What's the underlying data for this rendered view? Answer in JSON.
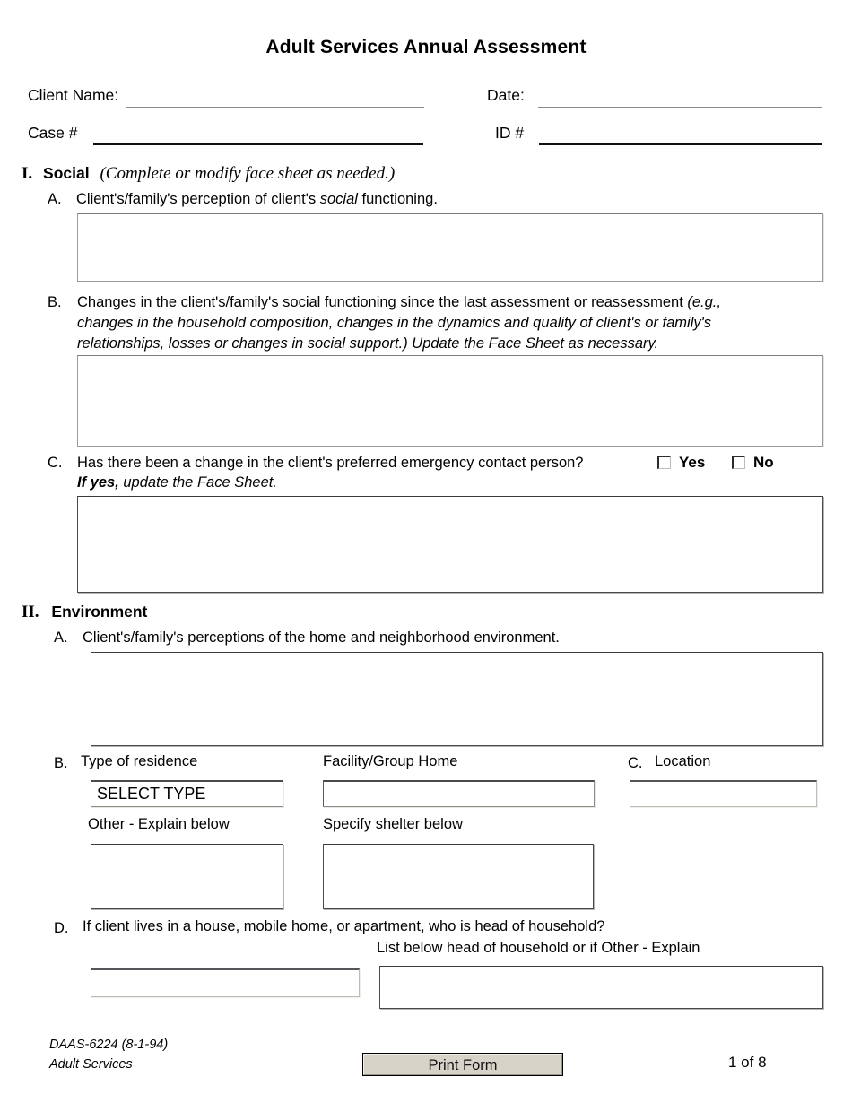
{
  "document": {
    "title": "Adult Services Annual Assessment"
  },
  "header": {
    "client_name_label": "Client Name:",
    "client_name_value": "",
    "date_label": "Date:",
    "date_value": "",
    "case_number_label": "Case #",
    "case_number_value": "",
    "id_number_label": "ID #",
    "id_number_value": ""
  },
  "sections": [
    {
      "number": "I.",
      "name": "Social",
      "note": "(Complete or modify face sheet as needed.)",
      "items": [
        {
          "letter": "A.",
          "text_line1_a": "Client's/family's perception of client's ",
          "text_line1_italic": "social",
          "text_line1_b": " functioning.",
          "answer": ""
        },
        {
          "letter": "B.",
          "line1_plain": "Changes in the client's/family's social functioning since the last assessment or reassessment ",
          "line1_italic": "(e.g.,",
          "line2_italic": "changes in the household composition, changes in the dynamics and quality of client's or family's",
          "line3_italic": "relationships, losses or changes in social support.)  Update the Face Sheet as necessary.",
          "answer": ""
        },
        {
          "letter": "C.",
          "question": "Has there been a change in the client's preferred emergency contact person?",
          "yes_label": "Yes",
          "no_label": "No",
          "yes_checked": false,
          "no_checked": false,
          "subnote_bold": "If yes,",
          "subnote_italic": " update the Face Sheet.",
          "answer": ""
        }
      ]
    },
    {
      "number": "II.",
      "name": "Environment",
      "note": "",
      "items": [
        {
          "letter": "A.",
          "text": "Client's/family's perceptions of the home and neighborhood environment.",
          "answer": ""
        },
        {
          "letter": "B.",
          "text": "Type of residence",
          "select_value": "SELECT TYPE",
          "sub_label": "Other - Explain below",
          "explain_answer": ""
        },
        {
          "letter": "",
          "text": "Facility/Group Home",
          "value": "",
          "sub_label": "Specify shelter below",
          "explain_answer": ""
        },
        {
          "letter": "C.",
          "text": "Location",
          "value": ""
        },
        {
          "letter": "D.",
          "text": "If client lives in a house, mobile home, or apartment, who is head of household?",
          "sub_label": "List below head of household or if Other - Explain",
          "value": "",
          "explain_answer": ""
        }
      ]
    }
  ],
  "footer": {
    "form_id": "DAAS-6224 (8-1-94)",
    "agency": "Adult Services",
    "print_button_label": "Print Form",
    "page_indicator": "1 of 8"
  }
}
